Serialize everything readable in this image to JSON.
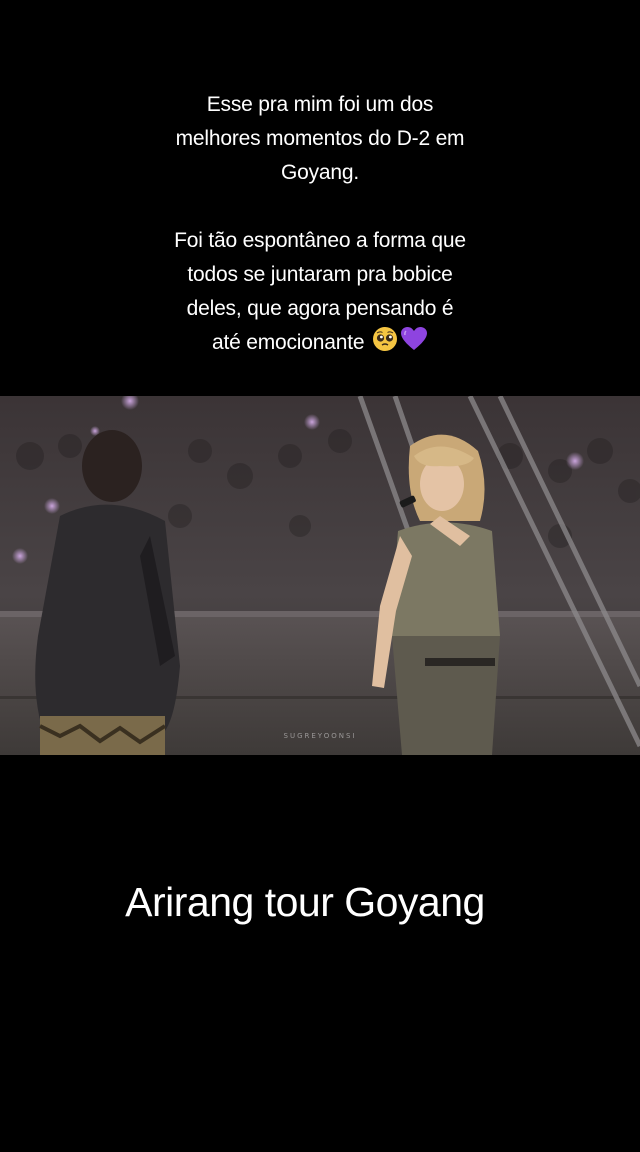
{
  "caption": {
    "paragraph1": "Esse pra mim foi um dos\nmelhores momentos do D-2 em\nGoyang.",
    "paragraph2_text": "Foi tão espontâneo a forma que\ntodos se juntaram pra bobice\ndeles, que agora pensando é\naté emocionante",
    "emojis": [
      "pleading-face-emoji",
      "purple-heart-emoji"
    ]
  },
  "photo": {
    "watermark": "SUGREYOONSI"
  },
  "overlay_title": "Arirang tour Goyang",
  "colors": {
    "background": "#000000",
    "text": "#ffffff",
    "heart": "#8e44e0",
    "emoji_face": "#f5c542"
  }
}
